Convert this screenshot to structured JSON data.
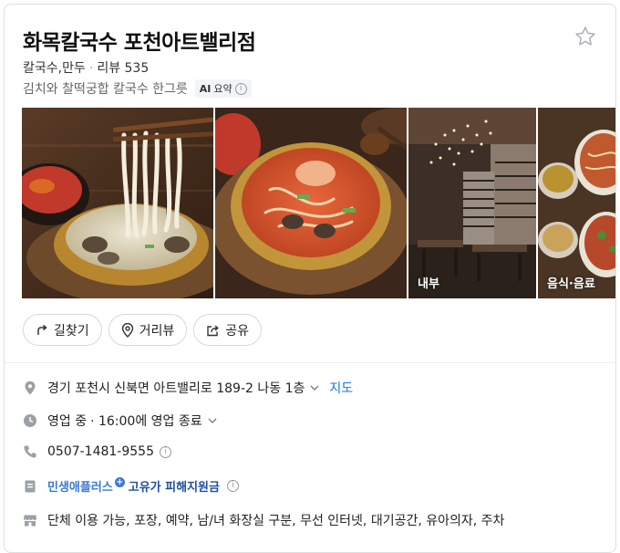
{
  "header": {
    "title": "화목칼국수 포천아트밸리점",
    "category": "칼국수,만두",
    "separator": "·",
    "review_label": "리뷰 535",
    "summary": "김치와 찰떡궁합 칼국수 한그릇",
    "ai_badge_ai": "AI",
    "ai_badge_label": "요약",
    "info_glyph": "i"
  },
  "photos": [
    {
      "id": "photo-1",
      "label": ""
    },
    {
      "id": "photo-2",
      "label": ""
    },
    {
      "id": "photo-3",
      "label": "내부"
    },
    {
      "id": "photo-4",
      "label": "음식·음료"
    }
  ],
  "actions": [
    {
      "label": "길찾기",
      "icon": "directions-icon"
    },
    {
      "label": "거리뷰",
      "icon": "location-pin-icon"
    },
    {
      "label": "공유",
      "icon": "share-icon"
    }
  ],
  "info": {
    "address": "경기 포천시 신북면 아트밸리로 189-2 나동 1층",
    "map_link": "지도",
    "hours_status": "영업 중",
    "hours_detail": "· 16:00에 영업 종료",
    "phone": "0507-1481-9555",
    "promo_brand": "민생애플러스",
    "promo_plus": "+",
    "promo_text": "고유가 피해지원금",
    "facilities": "단체 이용 가능, 포장, 예약, 남/녀 화장실 구분, 무선 인터넷, 대기공간, 유아의자, 주차"
  },
  "colors": {
    "link": "#1a73e8",
    "promo_brand": "#3c78d8",
    "promo_text": "#1d4fa3",
    "border": "#dcdfe3"
  }
}
